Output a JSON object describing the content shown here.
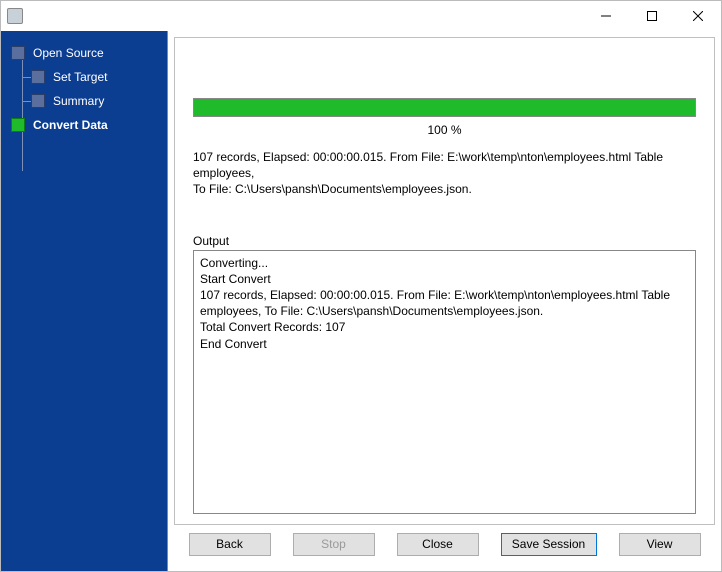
{
  "sidebar": {
    "items": [
      {
        "label": "Open Source",
        "active": false,
        "child": false
      },
      {
        "label": "Set Target",
        "active": false,
        "child": true
      },
      {
        "label": "Summary",
        "active": false,
        "child": true
      },
      {
        "label": "Convert Data",
        "active": true,
        "child": false
      }
    ]
  },
  "progress": {
    "percent_label": "100 %"
  },
  "status": {
    "line1": "107 records,    Elapsed: 00:00:00.015.    From File: E:\\work\\temp\\nton\\employees.html Table employees,",
    "line2": "To File: C:\\Users\\pansh\\Documents\\employees.json."
  },
  "output": {
    "label": "Output",
    "lines": [
      "Converting...",
      "Start Convert",
      "107 records,    Elapsed: 00:00:00.015.    From File: E:\\work\\temp\\nton\\employees.html Table employees,    To File: C:\\Users\\pansh\\Documents\\employees.json.",
      "Total Convert Records: 107",
      "End Convert"
    ]
  },
  "buttons": {
    "back": "Back",
    "stop": "Stop",
    "close": "Close",
    "save": "Save Session",
    "view": "View"
  }
}
